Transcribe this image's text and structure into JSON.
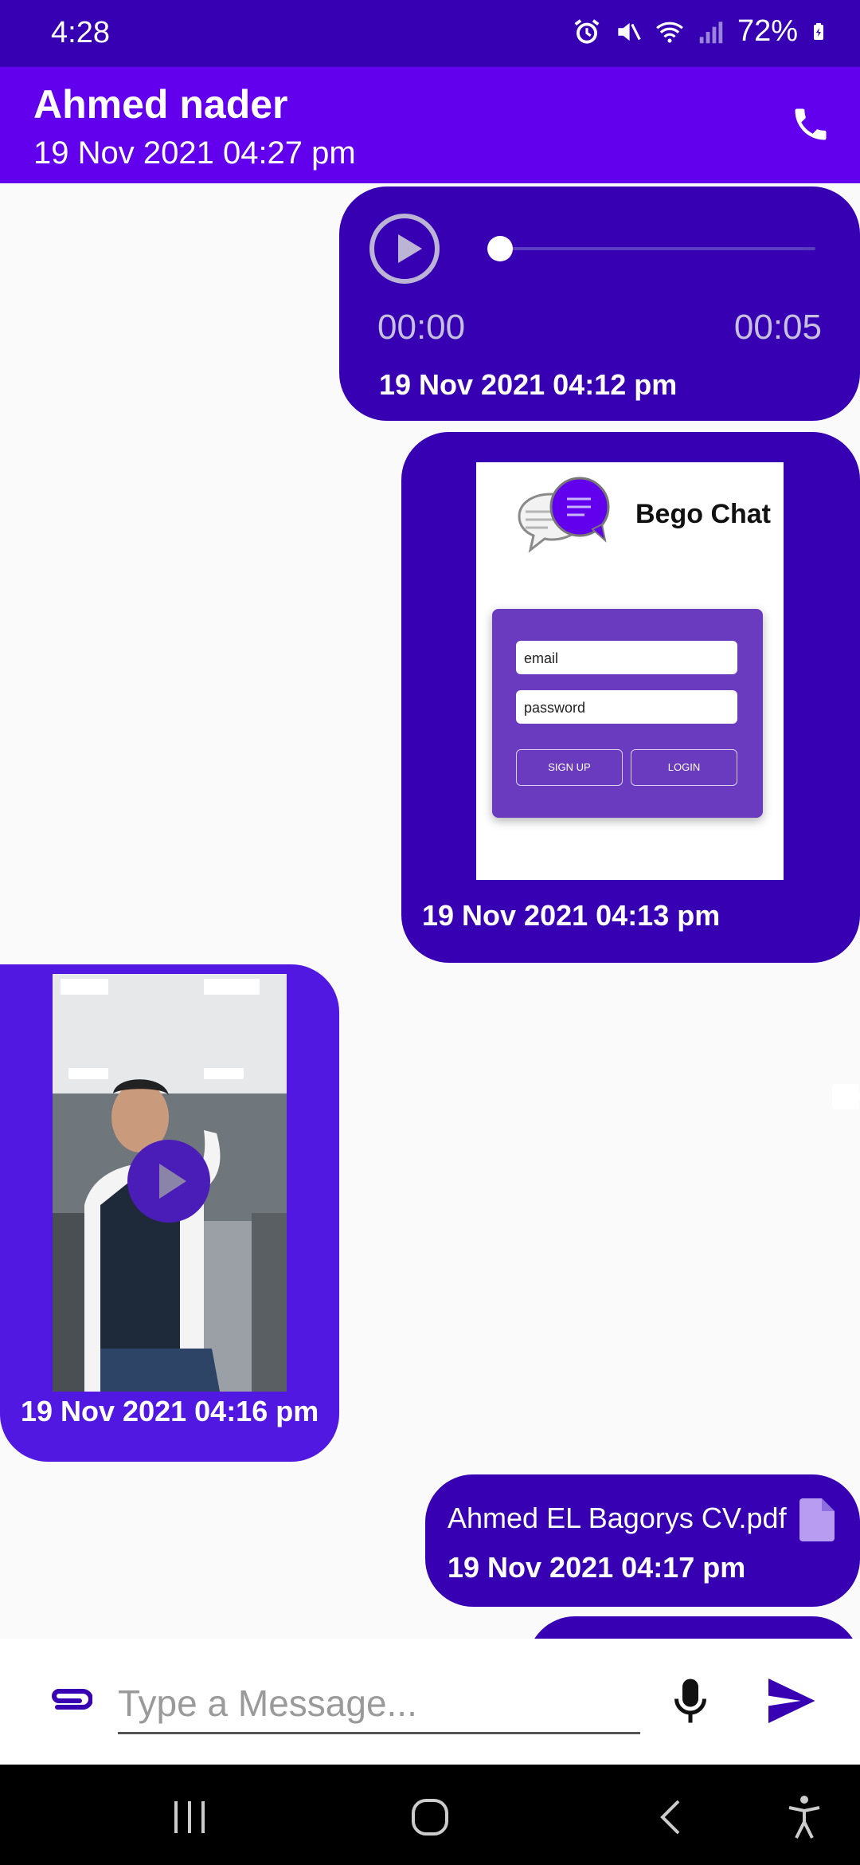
{
  "status_bar": {
    "time": "4:28",
    "battery": "72%"
  },
  "header": {
    "contact_name": "Ahmed nader",
    "last_seen": "19 Nov 2021 04:27 pm"
  },
  "messages": {
    "audio": {
      "elapsed": "00:00",
      "duration": "00:05",
      "progress": 0.0,
      "timestamp": "19 Nov 2021 04:12 pm"
    },
    "image": {
      "brand": "Bego Chat",
      "email_placeholder": "email",
      "password_placeholder": "password",
      "signup_label": "SIGN UP",
      "login_label": "LOGIN",
      "timestamp": "19 Nov 2021 04:13 pm"
    },
    "video": {
      "timestamp": "19 Nov 2021 04:16 pm"
    },
    "file": {
      "name": "Ahmed EL Bagorys CV.pdf",
      "timestamp": "19 Nov 2021 04:17 pm"
    }
  },
  "composer": {
    "placeholder": "Type a Message..."
  },
  "colors": {
    "status_bar": "#3700b3",
    "app_bar": "#6200ee",
    "outgoing_bubble": "#3700b3",
    "incoming_bubble": "#5018e0"
  }
}
